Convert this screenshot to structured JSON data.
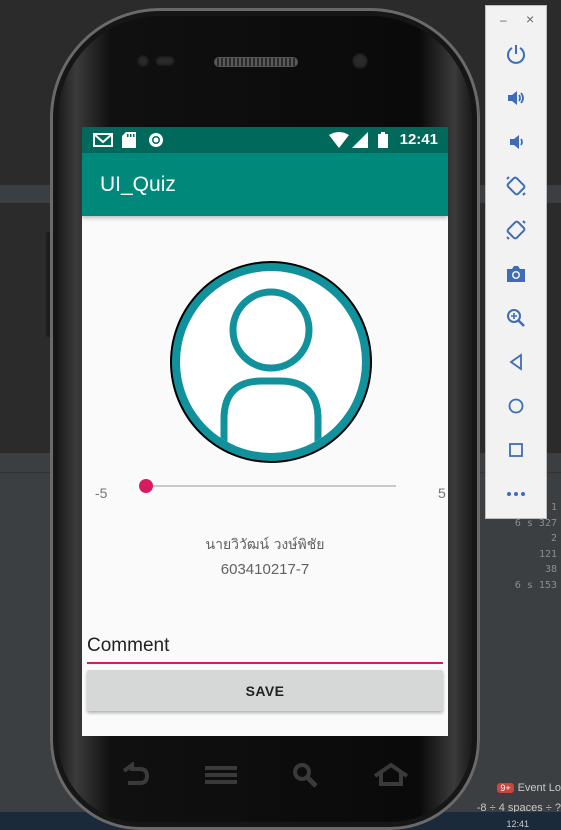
{
  "ide": {
    "right_numbers": [
      "1",
      "6 s 327",
      "2",
      "121",
      "38",
      "6 s 153"
    ],
    "event_badge": "9+",
    "event_log": "Event Lo",
    "info_bar": "-8 ÷  4 spaces ÷  ?",
    "clock": "12:41"
  },
  "status_bar": {
    "time": "12:41",
    "left_icons": [
      "gmail-icon",
      "sd-card-icon",
      "sync-icon"
    ],
    "right_icons": [
      "wifi-icon",
      "cell-signal-icon",
      "battery-icon"
    ]
  },
  "app_bar": {
    "title": "UI_Quiz"
  },
  "seekbar": {
    "min_label": "-5",
    "max_label": "5",
    "value": -5
  },
  "profile": {
    "name": "นายวิวัฒน์ วงษ์พิชัย",
    "student_id": "603410217-7"
  },
  "comment": {
    "value": "Comment"
  },
  "save_button": {
    "label": "SAVE"
  },
  "phone_nav": [
    "back-icon",
    "menu-icon",
    "search-icon",
    "home-icon"
  ],
  "emulator_panel": {
    "minimize": "–",
    "close": "×",
    "buttons": [
      "power-icon",
      "volume-up-icon",
      "volume-down-icon",
      "rotate-left-icon",
      "rotate-right-icon",
      "camera-icon",
      "zoom-icon",
      "back-icon",
      "home-icon",
      "overview-icon",
      "more-icon"
    ]
  },
  "colors": {
    "primary": "#00897b",
    "primary_dark": "#00695c",
    "accent": "#d81b60",
    "avatar": "#11919c"
  }
}
